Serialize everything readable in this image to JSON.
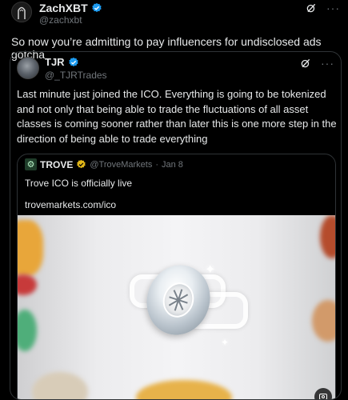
{
  "author": {
    "name": "ZachXBT",
    "handle": "@zachxbt"
  },
  "tweet": {
    "text": "So now you’re admitting to pay influencers for undisclosed ads gotcha"
  },
  "quoted": {
    "name": "TJR",
    "handle": "@_TJRTrades",
    "text": "Last minute just joined the ICO. Everything is going to be tokenized and not only that being able to trade the fluctuations of all asset classes is coming sooner rather than later this is one more step in the direction of being able to trade everything"
  },
  "nested": {
    "logo_glyph": "⚙",
    "name": "TROVE",
    "handle": "@TroveMarkets",
    "separator": "·",
    "date": "Jan 8",
    "text": "Trove ICO is officially live",
    "link": "trovemarkets.com/ico"
  },
  "colors": {
    "verified_blue": "#1d9bf0",
    "verified_gold": "#e2b719",
    "muted": "#71767b",
    "border": "#2f3336"
  },
  "icons": {
    "more": "···"
  }
}
